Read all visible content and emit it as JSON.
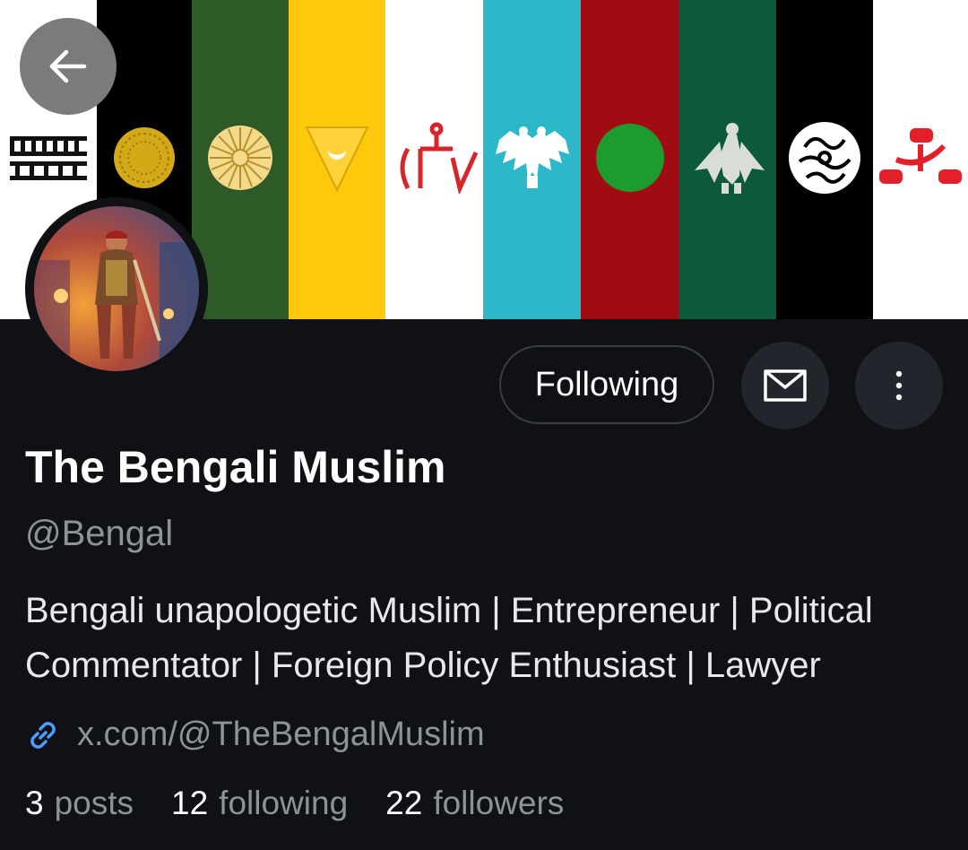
{
  "profile": {
    "name": "The Bengali Muslim",
    "handle": "@Bengal",
    "bio": "Bengali unapologetic Muslim | Entrepreneur | Political Commentator | Foreign Policy Enthusiast | Lawyer",
    "link": "x.com/@TheBengalMuslim"
  },
  "actions": {
    "following_label": "Following"
  },
  "stats": [
    {
      "value": "3",
      "label": "posts"
    },
    {
      "value": "12",
      "label": "following"
    },
    {
      "value": "22",
      "label": "followers"
    }
  ],
  "icons": {
    "back": "arrow-left-icon",
    "message": "envelope-icon",
    "more": "more-vertical-icon",
    "link": "link-icon"
  },
  "colors": {
    "background": "#0f1115",
    "muted_text": "#8e9299",
    "link_icon": "#4a9eff",
    "button_border": "#3a3d44"
  }
}
